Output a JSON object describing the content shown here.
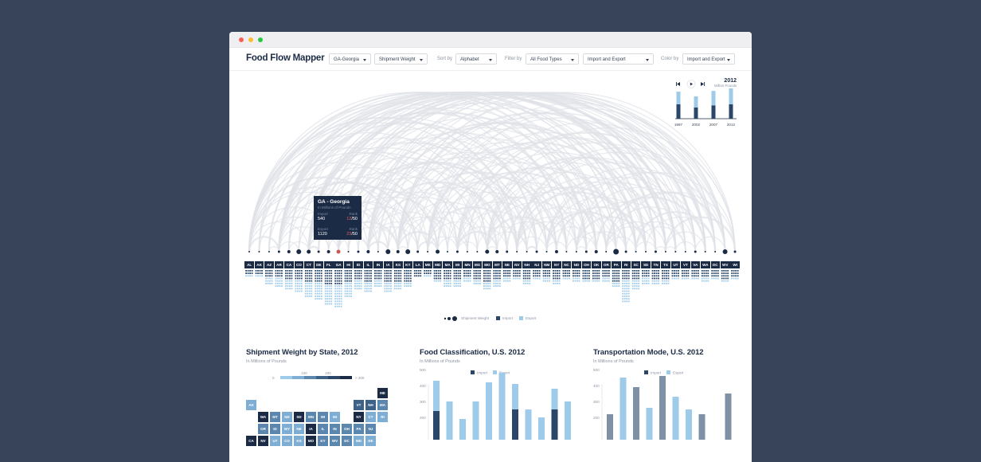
{
  "window": {
    "traffic_colors": [
      "#fc5f57",
      "#fdbc2e",
      "#28c840"
    ]
  },
  "toolbar": {
    "title": "Food Flow Mapper",
    "state_select": "GA-Georgia",
    "metric_select": "Shipment Weight",
    "sort_label": "Sort by",
    "sort_select": "Alphabet",
    "filter_label": "Filter by",
    "filter_select": "All Food Types",
    "flow_select": "Import and Export",
    "color_label": "Color by",
    "color_select": "Import and Export"
  },
  "timeline": {
    "year": "2012",
    "unit": "Million Pounds",
    "years": [
      "1997",
      "2002",
      "2007",
      "2012"
    ],
    "import": [
      0.45,
      0.35,
      0.42,
      0.45
    ],
    "export": [
      0.4,
      0.35,
      0.45,
      0.5
    ]
  },
  "tooltip": {
    "title": "GA - Georgia",
    "subtitle": "In Millions of Pounds",
    "import_label": "Import",
    "export_label": "Export",
    "rank_label": "Rank",
    "import_value": "540",
    "import_rank": "12",
    "import_total": "/50",
    "export_value": "1120",
    "export_rank": "23",
    "export_total": "/50"
  },
  "states": [
    "AL",
    "AK",
    "AZ",
    "AR",
    "CA",
    "CO",
    "CT",
    "DE",
    "FL",
    "GA",
    "HI",
    "ID",
    "IL",
    "IN",
    "IA",
    "KS",
    "KY",
    "LA",
    "ME",
    "MD",
    "MA",
    "MI",
    "MN",
    "MS",
    "MO",
    "MT",
    "NE",
    "NV",
    "NH",
    "NJ",
    "NM",
    "NY",
    "NC",
    "ND",
    "OH",
    "OK",
    "OR",
    "PA",
    "RI",
    "SC",
    "SD",
    "TN",
    "TX",
    "UT",
    "VT",
    "VA",
    "WA",
    "DC",
    "WV",
    "WI"
  ],
  "dot_sizes": [
    1,
    1,
    1,
    1.5,
    2,
    3,
    2.5,
    1.5,
    2,
    2.5,
    1,
    1.5,
    2,
    1,
    3,
    2,
    3,
    1.5,
    1,
    2.5,
    1,
    1.5,
    1,
    1,
    2.5,
    2,
    1.5,
    1,
    1,
    1.5,
    1,
    2,
    1,
    1,
    1.5,
    2,
    1,
    3.5,
    1.5,
    1,
    1,
    1.5,
    1,
    1,
    1,
    1.5,
    1,
    1,
    3,
    1.5
  ],
  "bar_import": [
    2,
    2,
    3,
    3,
    4,
    4,
    5,
    5,
    6,
    6,
    5,
    4,
    5,
    4,
    5,
    5,
    5,
    3,
    2,
    4,
    4,
    4,
    3,
    4,
    5,
    4,
    3,
    3,
    4,
    3,
    3,
    4,
    3,
    3,
    4,
    4,
    3,
    5,
    4,
    4,
    3,
    4,
    4,
    3,
    3,
    3,
    3,
    3,
    4,
    3
  ],
  "bar_export": [
    1,
    1,
    3,
    4,
    4,
    5,
    6,
    7,
    8,
    9,
    6,
    4,
    4,
    3,
    4,
    3,
    2,
    0,
    1,
    1,
    3,
    3,
    2,
    2,
    3,
    3,
    2,
    1,
    2,
    1,
    2,
    2,
    1,
    2,
    1,
    1,
    2,
    2,
    9,
    4,
    3,
    2,
    2,
    1,
    1,
    1,
    2,
    1,
    1,
    1
  ],
  "legend": {
    "weight": "Shipment Weight",
    "import": "Import",
    "export": "Export"
  },
  "colors": {
    "import": "#2a4769",
    "export": "#9fcbea",
    "navy": "#1c2b45"
  },
  "sections": [
    {
      "title": "Shipment Weight by State, 2012",
      "subtitle": "In Millions of Pounds"
    },
    {
      "title": "Food Classification, U.S. 2012",
      "subtitle": "In Millions of Pounds"
    },
    {
      "title": "Transportation Mode, U.S. 2012",
      "subtitle": "In Millions of Pounds"
    }
  ],
  "map_scale": {
    "ticks": [
      "0",
      "100",
      "200",
      "> 300"
    ]
  },
  "map_cells": [
    {
      "label": "ME",
      "c": 0,
      "r": 0,
      "v": 4
    },
    {
      "label": "AK",
      "c": 0,
      "r": 1,
      "v": 1
    },
    {
      "label": "VT",
      "c": 9,
      "r": 1,
      "v": 3
    },
    {
      "label": "NH",
      "c": 10,
      "r": 1,
      "v": 3
    },
    {
      "label": "MA",
      "c": 11,
      "r": 1,
      "v": 2
    },
    {
      "label": "WA",
      "c": 1,
      "r": 2,
      "v": 4
    },
    {
      "label": "MT",
      "c": 2,
      "r": 2,
      "v": 2
    },
    {
      "label": "ND",
      "c": 3,
      "r": 2,
      "v": 1
    },
    {
      "label": "SD",
      "c": 4,
      "r": 2,
      "v": 4
    },
    {
      "label": "MN",
      "c": 5,
      "r": 2,
      "v": 2
    },
    {
      "label": "WI",
      "c": 6,
      "r": 2,
      "v": 2
    },
    {
      "label": "MI",
      "c": 7,
      "r": 2,
      "v": 1
    },
    {
      "label": "NY",
      "c": 9,
      "r": 2,
      "v": 4
    },
    {
      "label": "CT",
      "c": 10,
      "r": 2,
      "v": 1
    },
    {
      "label": "RI",
      "c": 11,
      "r": 2,
      "v": 1
    },
    {
      "label": "OR",
      "c": 1,
      "r": 3,
      "v": 2
    },
    {
      "label": "ID",
      "c": 2,
      "r": 3,
      "v": 2
    },
    {
      "label": "WY",
      "c": 3,
      "r": 3,
      "v": 1
    },
    {
      "label": "NE",
      "c": 4,
      "r": 3,
      "v": 1
    },
    {
      "label": "IA",
      "c": 5,
      "r": 3,
      "v": 4
    },
    {
      "label": "IL",
      "c": 6,
      "r": 3,
      "v": 2
    },
    {
      "label": "IN",
      "c": 7,
      "r": 3,
      "v": 2
    },
    {
      "label": "OH",
      "c": 8,
      "r": 3,
      "v": 2
    },
    {
      "label": "PA",
      "c": 9,
      "r": 3,
      "v": 2
    },
    {
      "label": "NJ",
      "c": 10,
      "r": 3,
      "v": 2
    },
    {
      "label": "CA",
      "c": 0,
      "r": 4,
      "v": 4
    },
    {
      "label": "NV",
      "c": 1,
      "r": 4,
      "v": 4
    },
    {
      "label": "UT",
      "c": 2,
      "r": 4,
      "v": 1
    },
    {
      "label": "CO",
      "c": 3,
      "r": 4,
      "v": 1
    },
    {
      "label": "KS",
      "c": 4,
      "r": 4,
      "v": 1
    },
    {
      "label": "MO",
      "c": 5,
      "r": 4,
      "v": 4
    },
    {
      "label": "KY",
      "c": 6,
      "r": 4,
      "v": 2
    },
    {
      "label": "WV",
      "c": 7,
      "r": 4,
      "v": 2
    },
    {
      "label": "DC",
      "c": 8,
      "r": 4,
      "v": 2
    },
    {
      "label": "MD",
      "c": 9,
      "r": 4,
      "v": 1
    },
    {
      "label": "DE",
      "c": 10,
      "r": 4,
      "v": 1
    }
  ],
  "chart_data": [
    {
      "type": "bar",
      "title": "Food Classification, U.S. 2012",
      "subtitle": "In Millions of Pounds",
      "ylim": [
        0,
        500
      ],
      "yticks": [
        "500",
        "400",
        "300",
        "200"
      ],
      "series": [
        {
          "name": "Import",
          "values": [
            230,
            0,
            0,
            0,
            0,
            0,
            240,
            0,
            0,
            240,
            0
          ]
        },
        {
          "name": "Export",
          "values": [
            420,
            290,
            180,
            290,
            410,
            470,
            400,
            240,
            190,
            370,
            290
          ]
        }
      ]
    },
    {
      "type": "bar",
      "title": "Transportation Mode, U.S. 2012",
      "subtitle": "In Millions of Pounds",
      "ylim": [
        0,
        500
      ],
      "yticks": [
        "500",
        "400",
        "300",
        "200"
      ],
      "series": [
        {
          "name": "Import",
          "values": [
            210,
            0,
            380,
            0,
            450,
            0,
            0,
            210,
            0,
            340
          ]
        },
        {
          "name": "Export",
          "values": [
            0,
            440,
            0,
            250,
            0,
            320,
            240,
            0,
            0,
            0
          ]
        }
      ]
    }
  ]
}
